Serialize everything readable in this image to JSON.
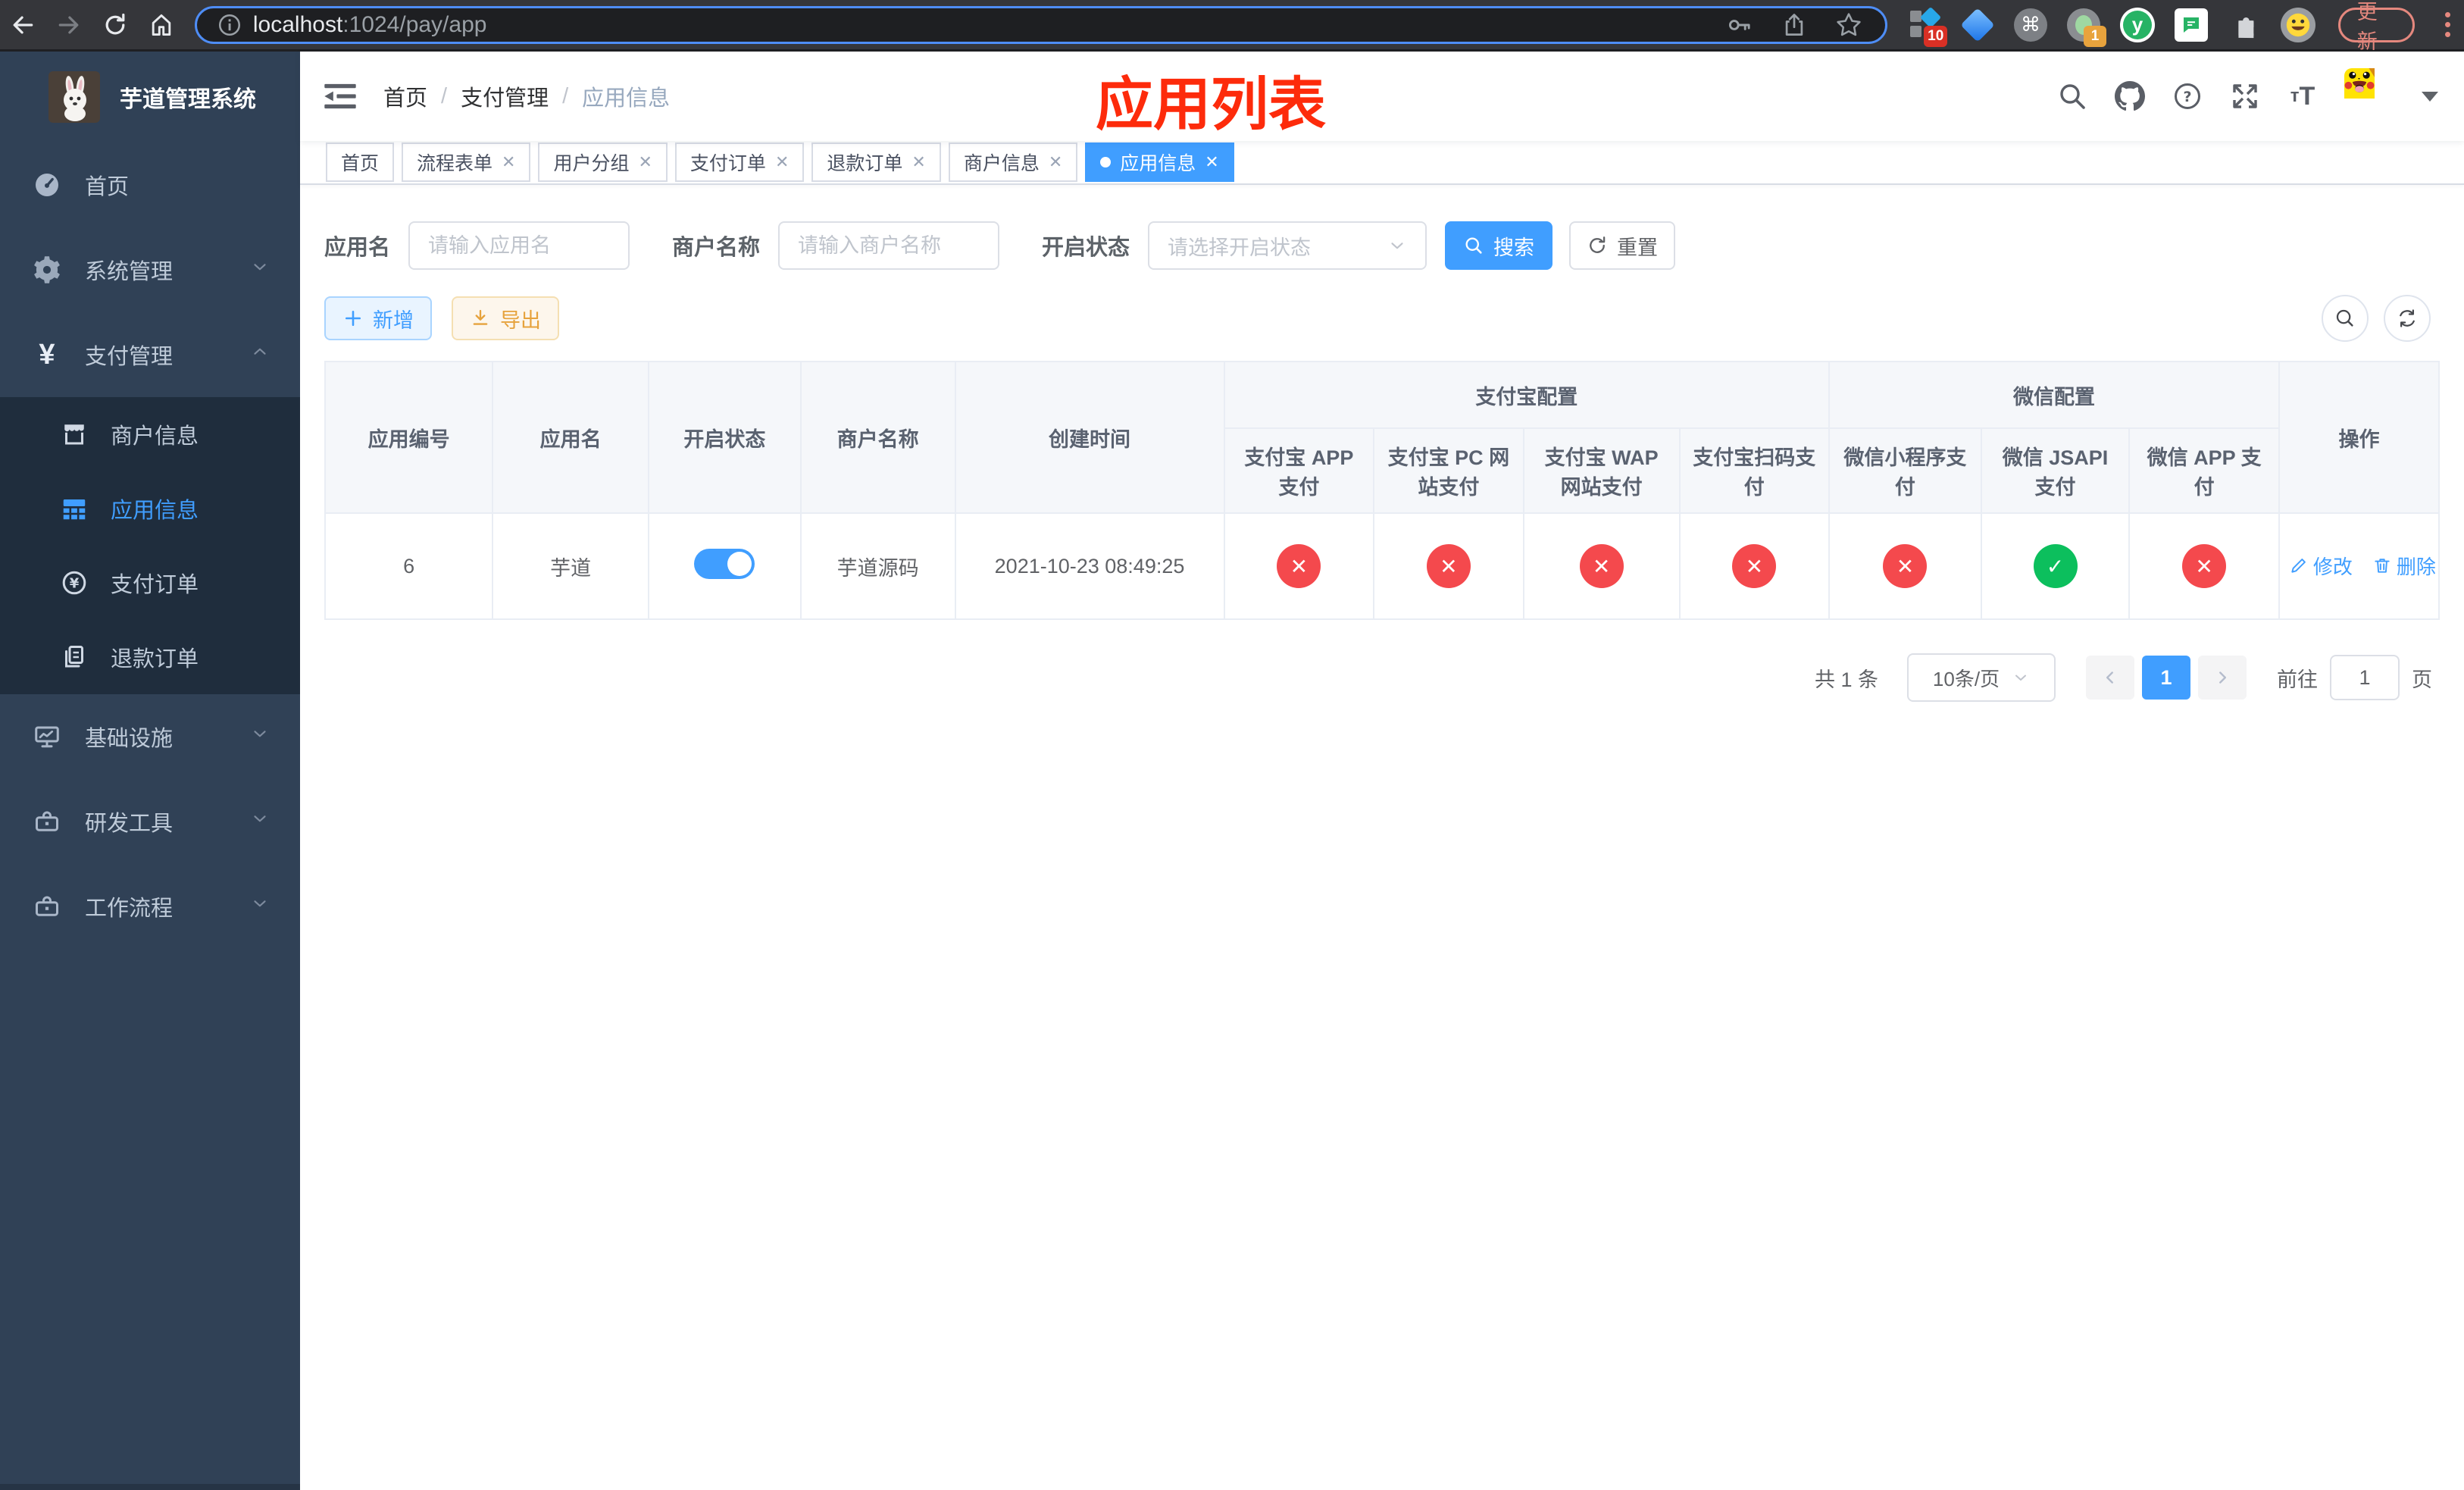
{
  "browser": {
    "url_host": "localhost",
    "url_path": ":1024/pay/app",
    "ext_badge_1": "10",
    "ext_badge_2": "1",
    "cmd_glyph": "⌘",
    "y_glyph": "y",
    "update_button": "更新"
  },
  "sidebar": {
    "title": "芋道管理系统",
    "menu": [
      {
        "label": "首页"
      },
      {
        "label": "系统管理"
      },
      {
        "label": "支付管理"
      },
      {
        "label": "基础设施"
      },
      {
        "label": "研发工具"
      },
      {
        "label": "工作流程"
      }
    ],
    "payment_submenu": [
      {
        "label": "商户信息"
      },
      {
        "label": "应用信息"
      },
      {
        "label": "支付订单"
      },
      {
        "label": "退款订单"
      }
    ],
    "yen_glyph": "¥"
  },
  "header": {
    "breadcrumb": [
      "首页",
      "支付管理",
      "应用信息"
    ],
    "page_title": "应用列表",
    "fontsize_icon_small": "т",
    "fontsize_icon_big": "T"
  },
  "tabs": [
    {
      "label": "首页"
    },
    {
      "label": "流程表单"
    },
    {
      "label": "用户分组"
    },
    {
      "label": "支付订单"
    },
    {
      "label": "退款订单"
    },
    {
      "label": "商户信息"
    },
    {
      "label": "应用信息"
    }
  ],
  "filters": {
    "name_label": "应用名",
    "name_placeholder": "请输入应用名",
    "merchant_label": "商户名称",
    "merchant_placeholder": "请输入商户名称",
    "status_label": "开启状态",
    "status_placeholder": "请选择开启状态",
    "search_label": "搜索",
    "reset_label": "重置"
  },
  "toolbar": {
    "add_label": "新增",
    "export_label": "导出"
  },
  "table": {
    "simple_columns": [
      "应用编号",
      "应用名",
      "开启状态",
      "商户名称",
      "创建时间"
    ],
    "groups": [
      {
        "label": "支付宝配置",
        "children": [
          "支付宝 APP 支付",
          "支付宝 PC 网站支付",
          "支付宝 WAP 网站支付",
          "支付宝扫码支付"
        ]
      },
      {
        "label": "微信配置",
        "children": [
          "微信小程序支付",
          "微信 JSAPI 支付",
          "微信 APP 支付"
        ]
      }
    ],
    "action_column": "操作",
    "rows": [
      {
        "id": "6",
        "name": "芋道",
        "enabled": "on",
        "merchant": "芋道源码",
        "created": "2021-10-23 08:49:25",
        "channels": [
          "off",
          "off",
          "off",
          "off",
          "off",
          "on",
          "off"
        ],
        "edit_label": "修改",
        "delete_label": "删除"
      }
    ]
  },
  "pagination": {
    "total": "共 1 条",
    "page_size": "10条/页",
    "current_page": "1",
    "goto_label": "前往",
    "goto_value": "1",
    "page_suffix": "页"
  },
  "colors": {
    "accent": "#409eff",
    "title_red": "#fd2b0b",
    "success_green": "#0cbf5d",
    "danger_red": "#f4494d",
    "sidebar_bg": "#304156",
    "submenu_bg": "#1f2d3d"
  }
}
